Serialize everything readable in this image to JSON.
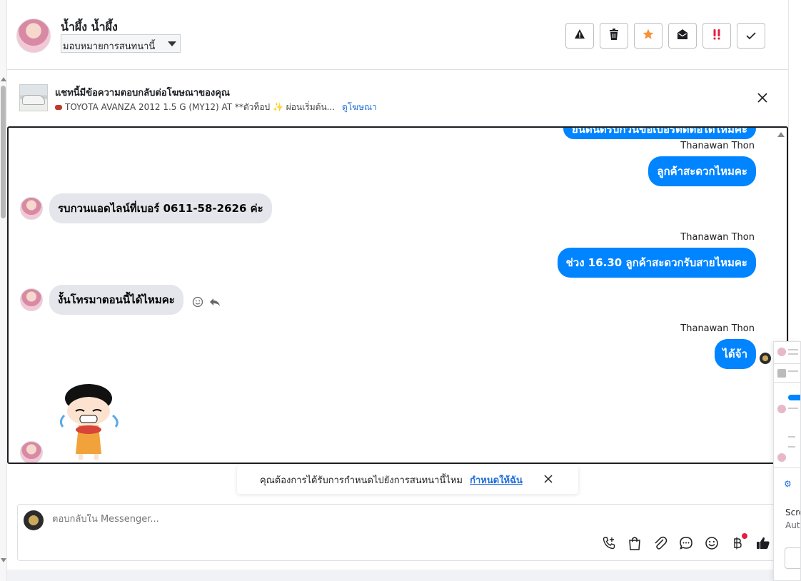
{
  "header": {
    "contact_name": "น้ำผึ้ง น้ำผึ้ง",
    "assign_label": "มอบหมายการสนทนานี้"
  },
  "ad_banner": {
    "title": "แชทนี้มีข้อความตอบกลับต่อโฆษณาของคุณ",
    "subtitle": "TOYOTA AVANZA 2012 1.5 G (MY12) AT **ตัวท็อป",
    "subtitle_tail": "ผ่อนเริ่มต้น...",
    "view_ad_link": "ดูโฆษณา"
  },
  "messages": {
    "top_partial": "ยินดีนัดรับกวนขอเบอร์ติดต่อได้ไหมคะ",
    "sender_1": "Thanawan Thon",
    "out_1": "ลูกค้าสะดวกไหมคะ",
    "in_1": "รบกวนแอดไลน์ที่เบอร์ 0611-58-2626 ค่ะ",
    "sender_2": "Thanawan Thon",
    "out_2": "ช่วง 16.30 ลูกค้าสะดวกรับสายไหมคะ",
    "in_2": "งั้นโทรมาตอนนี้ได้ไหมคะ",
    "sender_3": "Thanawan Thon",
    "out_3": "ได้จ้า"
  },
  "toast": {
    "text": "คุณต้องการได้รับการกำหนดไปยังการสนทนานี้ไหม",
    "link": "กำหนดให้ฉัน"
  },
  "composer": {
    "placeholder": "ตอบกลับใน Messenger..."
  },
  "mini_window": {
    "line_1": "Scre",
    "line_2": "Auto"
  },
  "colors": {
    "outgoing_bubble": "#0084ff",
    "incoming_bubble": "#e4e6eb",
    "link": "#216fdb",
    "star": "#f7923a",
    "important": "#e41e3f"
  },
  "icons": {
    "actions": [
      "warning-icon",
      "trash-icon",
      "star-icon",
      "mark-unread-icon",
      "important-icon",
      "check-icon"
    ],
    "composer_tools": [
      "phone-add-icon",
      "shopping-bag-icon",
      "paperclip-icon",
      "saved-reply-icon",
      "emoji-icon",
      "baht-payment-icon",
      "thumbs-up-icon"
    ]
  }
}
